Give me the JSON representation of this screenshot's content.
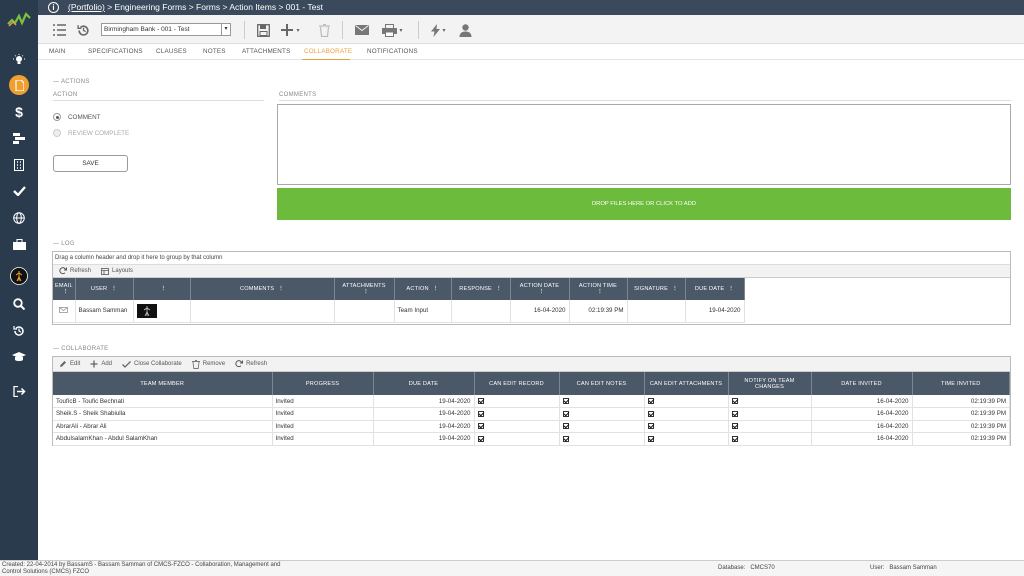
{
  "breadcrumb": {
    "link": "(Portfolio)",
    "rest": " > Engineering Forms > Forms > Action Items > 001 - Test"
  },
  "toolbar": {
    "project_select": "Birmingham Bank - 001 - Test"
  },
  "tabs": [
    {
      "label": "MAIN"
    },
    {
      "label": "SPECIFICATIONS"
    },
    {
      "label": "CLAUSES"
    },
    {
      "label": "NOTES"
    },
    {
      "label": "ATTACHMENTS"
    },
    {
      "label": "COLLABORATE"
    },
    {
      "label": "NOTIFICATIONS"
    }
  ],
  "actions": {
    "section_title": "ACTIONS",
    "action_label": "ACTION",
    "comments_label": "COMMENTS",
    "options": [
      "COMMENT",
      "REVIEW COMPLETE"
    ],
    "save_label": "SAVE",
    "drop_label": "DROP FILES HERE OR CLICK TO ADD"
  },
  "log": {
    "section_title": "LOG",
    "group_hint": "Drag a column header and drop it here to group by that column",
    "refresh_label": "Refresh",
    "layouts_label": "Layouts",
    "columns": [
      "EMAIL",
      "USER",
      "",
      "COMMENTS",
      "ATTACHMENTS",
      "ACTION",
      "RESPONSE",
      "ACTION DATE",
      "ACTION TIME",
      "SIGNATURE",
      "DUE DATE"
    ],
    "rows": [
      {
        "user": "Bassam Samman",
        "comments": "",
        "attachments": "",
        "action": "Team Input",
        "response": "",
        "action_date": "16-04-2020",
        "action_time": "02:19:39 PM",
        "signature": "",
        "due_date": "19-04-2020"
      }
    ]
  },
  "collaborate": {
    "section_title": "COLLABORATE",
    "toolbar": {
      "edit": "Edit",
      "add": "Add",
      "close": "Close Collaborate",
      "remove": "Remove",
      "refresh": "Refresh"
    },
    "columns": [
      "TEAM MEMBER",
      "PROGRESS",
      "DUE DATE",
      "CAN EDIT RECORD",
      "CAN EDIT NOTES",
      "CAN EDIT ATTACHMENTS",
      "NOTIFY ON TEAM CHANGES",
      "DATE INVITED",
      "TIME INVITED"
    ],
    "rows": [
      {
        "member": "ToufícB - Toufic Bechnati",
        "progress": "Invited",
        "due_date": "19-04-2020",
        "date_invited": "16-04-2020",
        "time_invited": "02:19:39 PM"
      },
      {
        "member": "Sheik.S - Sheik Shabiulla",
        "progress": "Invited",
        "due_date": "19-04-2020",
        "date_invited": "16-04-2020",
        "time_invited": "02:19:39 PM"
      },
      {
        "member": "AbrarAli - Abrar Ali",
        "progress": "Invited",
        "due_date": "19-04-2020",
        "date_invited": "16-04-2020",
        "time_invited": "02:19:39 PM"
      },
      {
        "member": "AbdulsalamKhan - Abdul SalamKhan",
        "progress": "Invited",
        "due_date": "19-04-2020",
        "date_invited": "16-04-2020",
        "time_invited": "02:19:39 PM"
      }
    ]
  },
  "footer": {
    "created": "Created: 22-04-2014 by BassamS - Bassam Samman of CMCS-FZCO - Collaboration, Management and Control Solutions (CMCS) FZCO",
    "database": "Database:   CMCS70",
    "user": "User:   Bassam Samman"
  },
  "icons": {
    "logo": "logo-icon",
    "sidebar": [
      "lightbulb-icon",
      "document-icon",
      "dollar-icon",
      "gantt-icon",
      "building-icon",
      "check-icon",
      "globe-icon",
      "briefcase-icon",
      "figure-icon",
      "search-icon",
      "history-icon",
      "graduation-cap-icon",
      "logout-icon"
    ]
  },
  "colors": {
    "accent": "#e8a040",
    "drop_zone": "#6cbb3c",
    "sidebar": "#2b3b4e",
    "grid_header": "#4a5868"
  }
}
